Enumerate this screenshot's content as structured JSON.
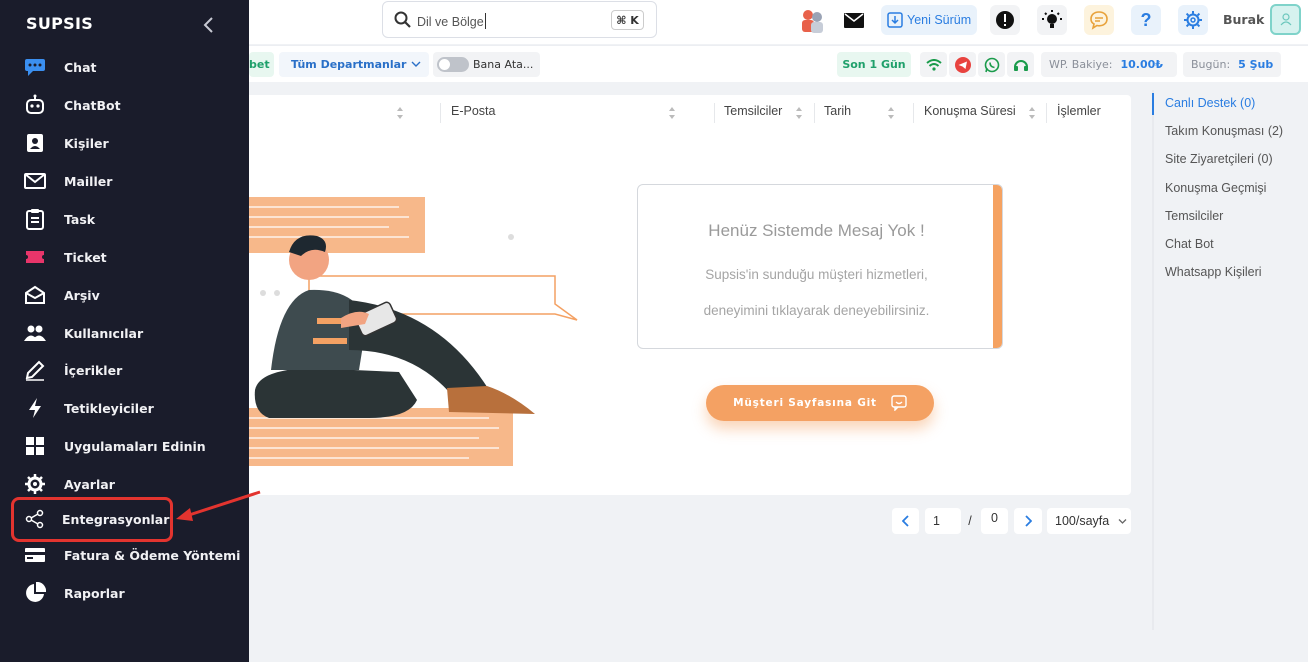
{
  "sidebar": {
    "brand": "SUPSIS",
    "items": [
      {
        "label": "Chat",
        "icon": "chat-bubbles-icon"
      },
      {
        "label": "ChatBot",
        "icon": "robot-icon"
      },
      {
        "label": "Kişiler",
        "icon": "contact-card-icon"
      },
      {
        "label": "Mailler",
        "icon": "envelope-icon"
      },
      {
        "label": "Task",
        "icon": "clipboard-icon"
      },
      {
        "label": "Ticket",
        "icon": "ticket-icon"
      },
      {
        "label": "Arşiv",
        "icon": "archive-icon"
      },
      {
        "label": "Kullanıcılar",
        "icon": "users-icon"
      },
      {
        "label": "İçerikler",
        "icon": "pencil-icon"
      },
      {
        "label": "Tetikleyiciler",
        "icon": "lightning-icon"
      },
      {
        "label": "Uygulamaları Edinin",
        "icon": "grid-apps-icon"
      },
      {
        "label": "Ayarlar",
        "icon": "gear-icon"
      },
      {
        "label": "Entegrasyonlar",
        "icon": "share-nodes-icon"
      },
      {
        "label": "Fatura & Ödeme Yöntemi",
        "icon": "credit-card-icon"
      },
      {
        "label": "Raporlar",
        "icon": "pie-chart-icon"
      }
    ],
    "highlighted": "Entegrasyonlar",
    "highlight_color": "#e3342f"
  },
  "topbar": {
    "search_text": "Dil ve Bölge",
    "shortcut": "⌘ K",
    "update_label": "Yeni Sürüm",
    "user_name": "Burak"
  },
  "filterbar": {
    "partial_pill": "bet",
    "department": "Tüm Departmanlar",
    "toggle_label": "Bana Ata...",
    "time_range": "Son 1 Gün",
    "wp_balance_label": "WP. Bakiye:",
    "wp_balance_value": "10.00₺",
    "today_label": "Bugün:",
    "today_value": "5 Şub"
  },
  "table": {
    "columns": [
      "E-Posta",
      "Temsilciler",
      "Tarih",
      "Konuşma Süresi",
      "İşlemler"
    ]
  },
  "empty_state": {
    "title": "Henüz Sistemde Mesaj Yok !",
    "line1": "Supsis'in sunduğu müşteri hizmetleri,",
    "line2": "deneyimini tıklayarak deneyebilirsiniz.",
    "cta": "Müşteri Sayfasına Git"
  },
  "pagination": {
    "current_page": "1",
    "separator": "/",
    "total_pages": "0",
    "page_size": "100/sayfa"
  },
  "right_nav": {
    "items": [
      "Canlı Destek (0)",
      "Takım Konuşması (2)",
      "Site Ziyaretçileri (0)",
      "Konuşma Geçmişi",
      "Temsilciler",
      "Chat Bot",
      "Whatsapp Kişileri"
    ],
    "active": "Canlı Destek (0)"
  },
  "colors": {
    "sidebar_bg": "#1a1c2b",
    "accent_blue": "#2a7de1",
    "accent_orange": "#f4a163"
  }
}
